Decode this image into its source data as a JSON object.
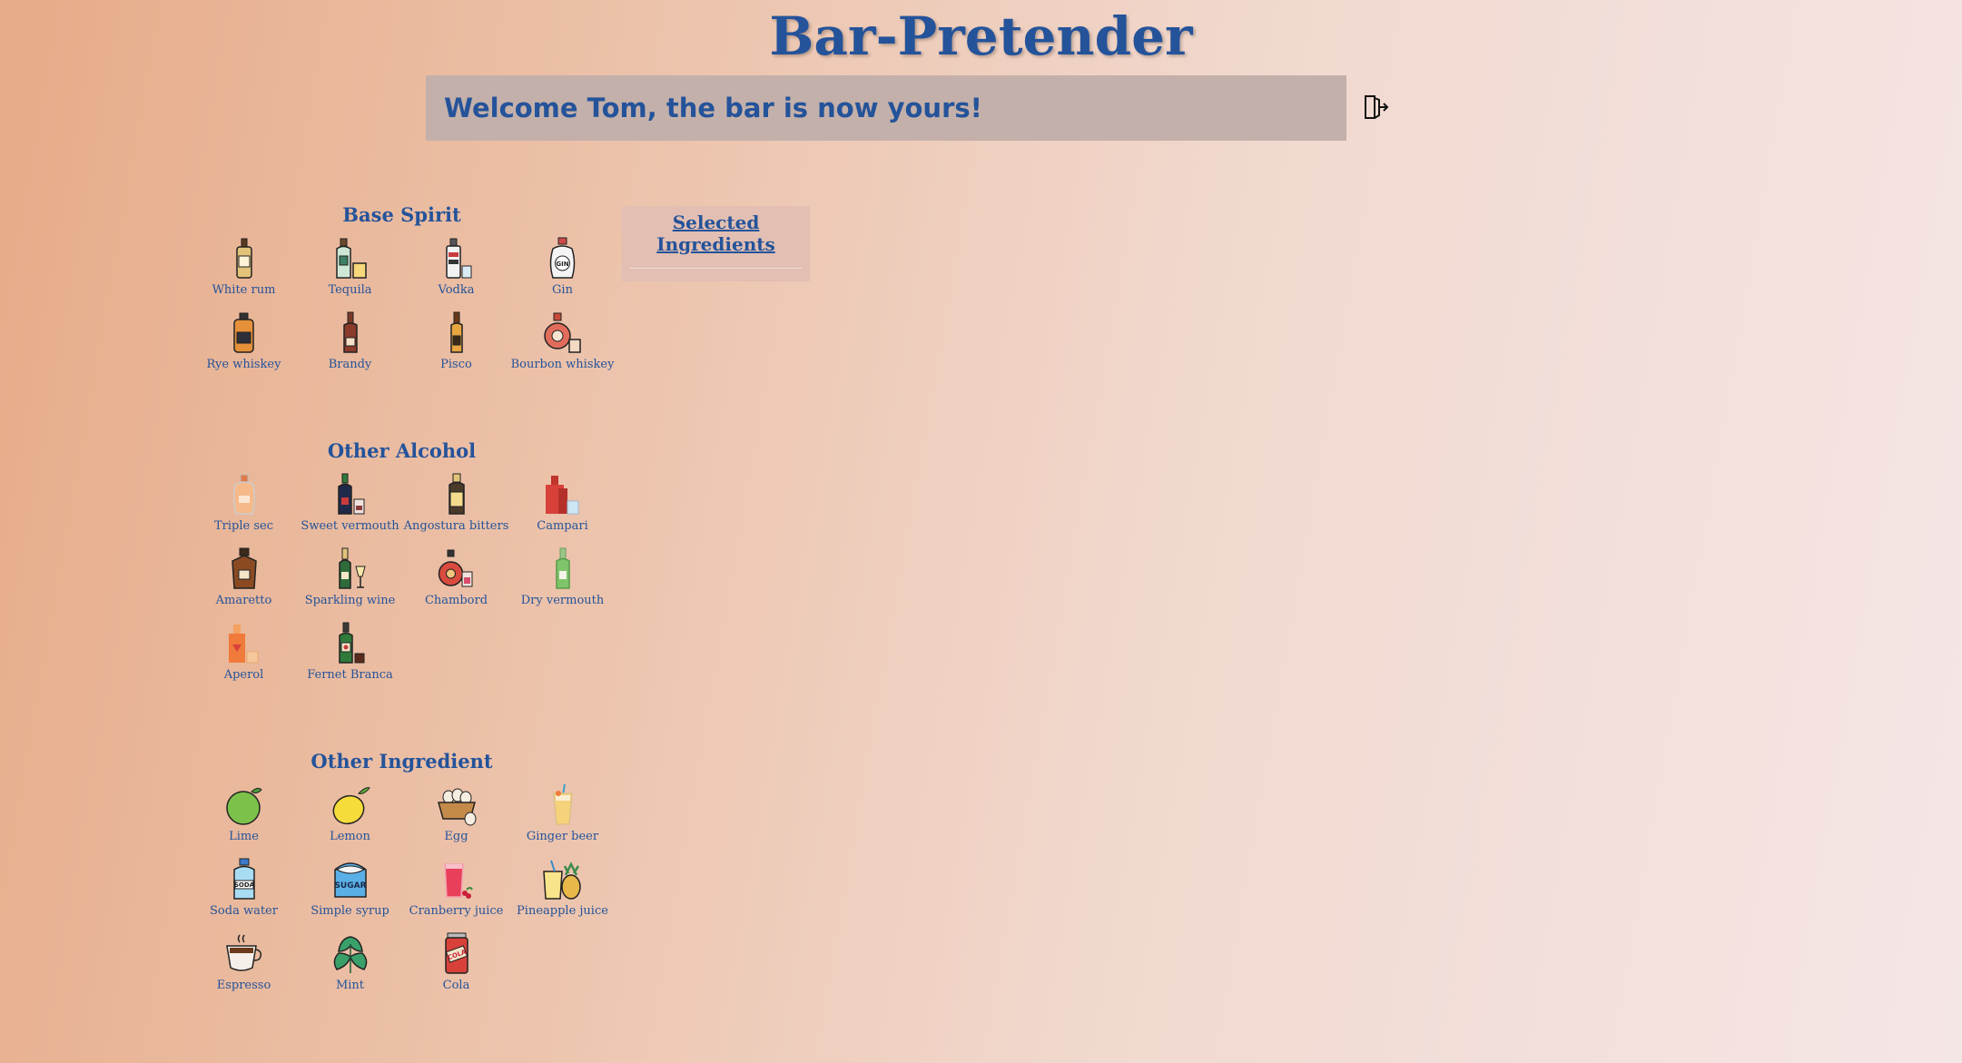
{
  "app": {
    "title": "Bar-Pretender",
    "welcome": "Welcome Tom, the bar is now yours!"
  },
  "selected_panel": {
    "title_line1": "Selected",
    "title_line2": "Ingredients"
  },
  "sections": {
    "base_spirit": {
      "title": "Base Spirit",
      "items": [
        "White rum",
        "Tequila",
        "Vodka",
        "Gin",
        "Rye whiskey",
        "Brandy",
        "Pisco",
        "Bourbon whiskey"
      ]
    },
    "other_alcohol": {
      "title": "Other Alcohol",
      "items": [
        "Triple sec",
        "Sweet vermouth",
        "Angostura bitters",
        "Campari",
        "Amaretto",
        "Sparkling wine",
        "Chambord",
        "Dry vermouth",
        "Aperol",
        "Fernet Branca"
      ]
    },
    "other_ingredient": {
      "title": "Other Ingredient",
      "items": [
        "Lime",
        "Lemon",
        "Egg",
        "Ginger beer",
        "Soda water",
        "Simple syrup",
        "Cranberry juice",
        "Pineapple juice",
        "Espresso",
        "Mint",
        "Cola"
      ]
    }
  },
  "icons": {
    "logout": "logout-icon"
  },
  "colors": {
    "accent": "#24539a",
    "welcome_bg": "#c4b0aa",
    "panel_bg": "#e2bfb2"
  }
}
